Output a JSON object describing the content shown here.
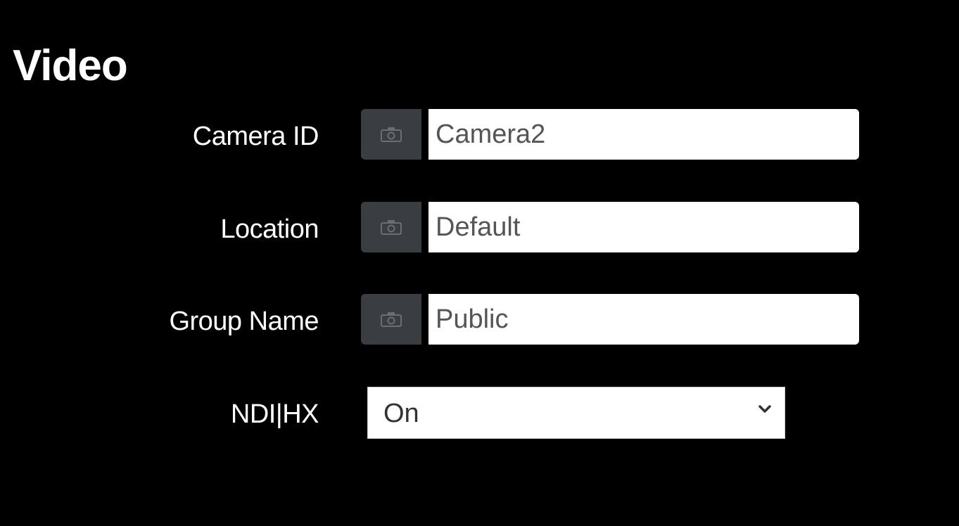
{
  "section": {
    "title": "Video"
  },
  "fields": [
    {
      "label": "Camera ID",
      "value": "Camera2",
      "icon": "camera-icon"
    },
    {
      "label": "Location",
      "value": "Default",
      "icon": "camera-icon"
    },
    {
      "label": "Group Name",
      "value": "Public",
      "icon": "camera-icon"
    }
  ],
  "ndi": {
    "label": "NDI|HX",
    "selected": "On"
  },
  "colors": {
    "background": "#000000",
    "addon": "#3a3d42",
    "input_background": "#ffffff"
  }
}
